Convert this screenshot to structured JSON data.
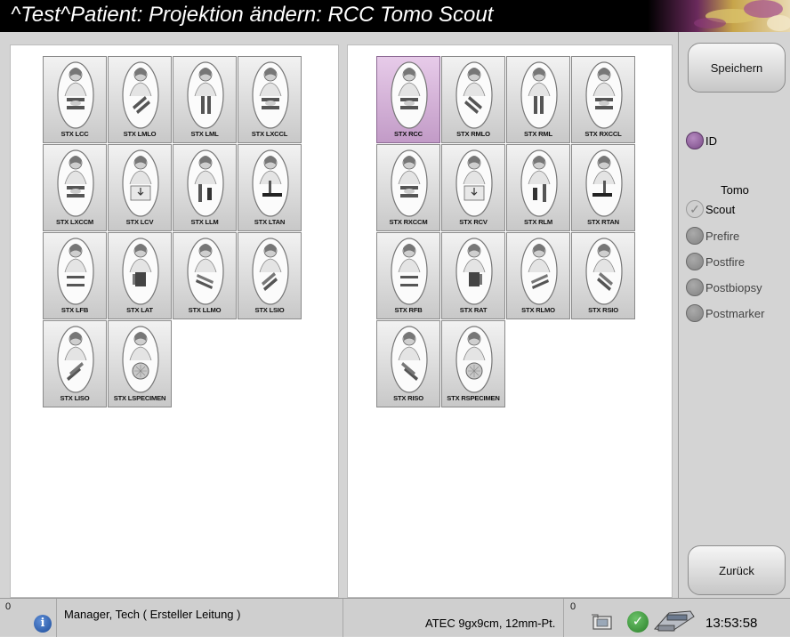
{
  "window": {
    "title": "^Test^Patient: Projektion ändern: RCC Tomo Scout"
  },
  "left_views": [
    {
      "label": "STX LCC",
      "kind": "cc",
      "side": "L"
    },
    {
      "label": "STX LMLO",
      "kind": "mlo",
      "side": "L"
    },
    {
      "label": "STX LML",
      "kind": "ml",
      "side": "L"
    },
    {
      "label": "STX LXCCL",
      "kind": "cc",
      "side": "L"
    },
    {
      "label": "STX LXCCM",
      "kind": "cc",
      "side": "L"
    },
    {
      "label": "STX LCV",
      "kind": "cv",
      "side": "L"
    },
    {
      "label": "STX LLM",
      "kind": "lm",
      "side": "L"
    },
    {
      "label": "STX LTAN",
      "kind": "tan",
      "side": "L"
    },
    {
      "label": "STX LFB",
      "kind": "fb",
      "side": "L"
    },
    {
      "label": "STX LAT",
      "kind": "lat",
      "side": "L"
    },
    {
      "label": "STX LLMO",
      "kind": "lmo",
      "side": "L"
    },
    {
      "label": "STX LSIO",
      "kind": "sio",
      "side": "L"
    },
    {
      "label": "STX LISO",
      "kind": "iso",
      "side": "L"
    },
    {
      "label": "STX LSPECIMEN",
      "kind": "spec",
      "side": "L"
    }
  ],
  "right_views": [
    {
      "label": "STX RCC",
      "kind": "cc",
      "side": "R",
      "selected": true
    },
    {
      "label": "STX RMLO",
      "kind": "mlo",
      "side": "R"
    },
    {
      "label": "STX RML",
      "kind": "ml",
      "side": "R"
    },
    {
      "label": "STX RXCCL",
      "kind": "cc",
      "side": "R"
    },
    {
      "label": "STX RXCCM",
      "kind": "cc",
      "side": "R"
    },
    {
      "label": "STX RCV",
      "kind": "cv",
      "side": "R"
    },
    {
      "label": "STX RLM",
      "kind": "lm",
      "side": "R"
    },
    {
      "label": "STX RTAN",
      "kind": "tan",
      "side": "R"
    },
    {
      "label": "STX RFB",
      "kind": "fb",
      "side": "R"
    },
    {
      "label": "STX RAT",
      "kind": "lat",
      "side": "R"
    },
    {
      "label": "STX RLMO",
      "kind": "lmo",
      "side": "R"
    },
    {
      "label": "STX RSIO",
      "kind": "sio",
      "side": "R"
    },
    {
      "label": "STX RISO",
      "kind": "iso",
      "side": "R"
    },
    {
      "label": "STX RSPECIMEN",
      "kind": "spec",
      "side": "R"
    }
  ],
  "sidebar": {
    "save_label": "Speichern",
    "back_label": "Zurück",
    "id_label": "ID",
    "tomo_heading": "Tomo",
    "tomo_options": {
      "scout": "Scout",
      "prefire": "Prefire",
      "postfire": "Postfire",
      "postbiopsy": "Postbiopsy",
      "postmarker": "Postmarker"
    }
  },
  "statusbar": {
    "alert_count": "0",
    "user": "Manager, Tech ( Ersteller Leitung )",
    "paddle": "ATEC 9gx9cm, 12mm-Pt.",
    "paddle_count": "0",
    "time": "13:53:58"
  },
  "colors": {
    "selected_tile": "#e7cbe9",
    "accent_purple": "#7a4b87"
  }
}
